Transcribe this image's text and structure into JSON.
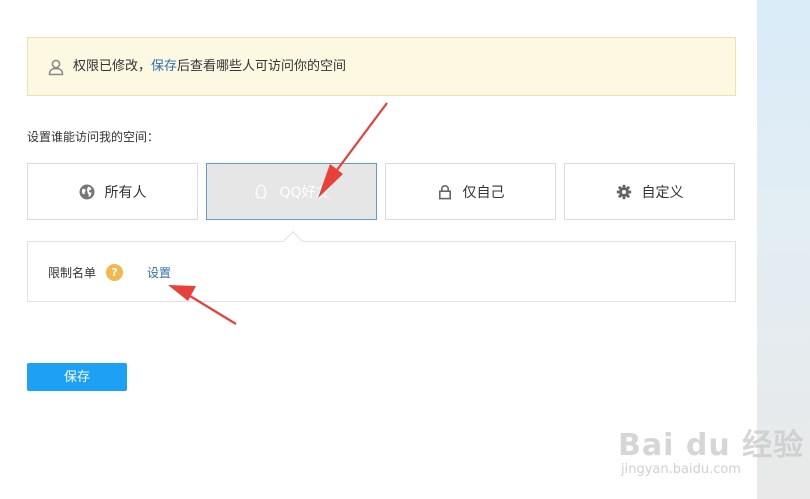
{
  "notice": {
    "text_before": "权限已修改，",
    "link": "保存",
    "text_after": "后查看哪些人可访问你的空间",
    "icon": "user-icon"
  },
  "section_label": "设置谁能访问我的空间：",
  "options": [
    {
      "label": "所有人",
      "icon": "globe-icon",
      "selected": false
    },
    {
      "label": "QQ好友",
      "icon": "qq-penguin-icon",
      "selected": true
    },
    {
      "label": "仅自己",
      "icon": "lock-icon",
      "selected": false
    },
    {
      "label": "自定义",
      "icon": "gear-icon",
      "selected": false
    }
  ],
  "restrict": {
    "label": "限制名单",
    "help": "?",
    "link": "设置"
  },
  "save_button": "保存",
  "watermark": {
    "logo": "Bai du 经验",
    "url": "jingyan.baidu.com"
  },
  "colors": {
    "accent": "#1ea0f5",
    "link": "#2d6fb4",
    "notice_bg": "#fdf8e2",
    "help_badge": "#f2b84b",
    "annotation_arrow": "#e8403a",
    "selected_border": "#5a9fd0"
  }
}
